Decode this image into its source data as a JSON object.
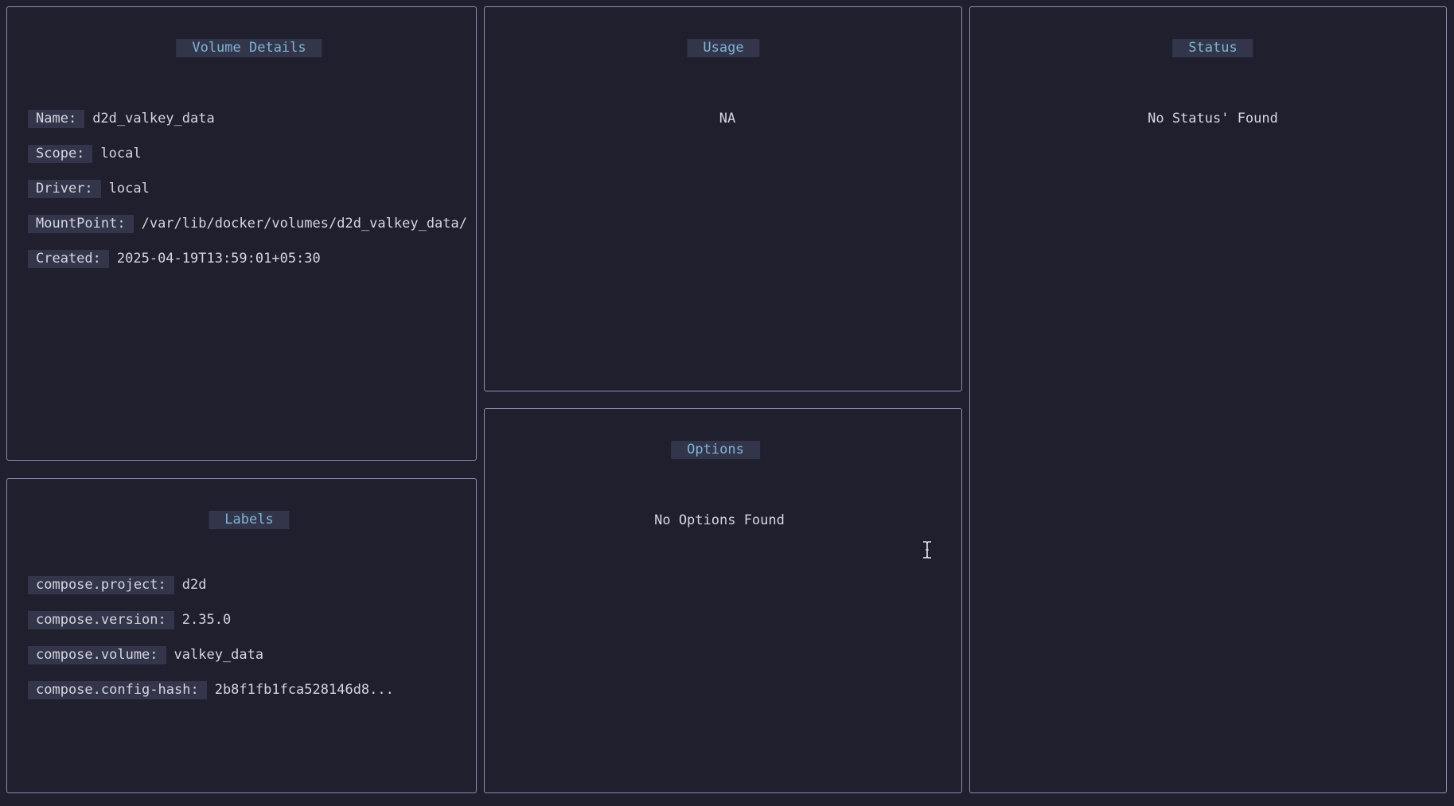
{
  "volume_details": {
    "title": "Volume Details",
    "fields": [
      {
        "key": "Name:",
        "value": "d2d_valkey_data"
      },
      {
        "key": "Scope:",
        "value": "local"
      },
      {
        "key": "Driver:",
        "value": "local"
      },
      {
        "key": "MountPoint:",
        "value": "/var/lib/docker/volumes/d2d_valkey_data/"
      },
      {
        "key": "Created:",
        "value": "2025-04-19T13:59:01+05:30"
      }
    ]
  },
  "usage": {
    "title": "Usage",
    "value": "NA"
  },
  "status": {
    "title": "Status",
    "message": "No Status' Found"
  },
  "options": {
    "title": "Options",
    "message": "No Options Found"
  },
  "labels": {
    "title": "Labels",
    "fields": [
      {
        "key": "compose.project:",
        "value": "d2d"
      },
      {
        "key": "compose.version:",
        "value": "2.35.0"
      },
      {
        "key": "compose.volume:",
        "value": "valkey_data"
      },
      {
        "key": "compose.config-hash:",
        "value": "2b8f1fb1fca528146d8..."
      }
    ]
  },
  "colors": {
    "background": "#1f1f2e",
    "border": "#8a8fb5",
    "title_text": "#7fb4d6",
    "key_bg": "#33364a"
  },
  "icons": {
    "cursor": "text-cursor-icon"
  }
}
